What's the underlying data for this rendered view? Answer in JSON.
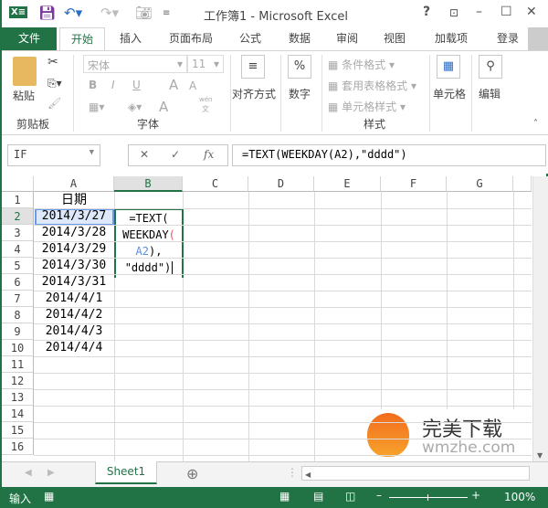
{
  "app": {
    "title": "工作簿1 - Microsoft Excel"
  },
  "tabs": [
    {
      "label": "文件"
    },
    {
      "label": "开始"
    },
    {
      "label": "插入"
    },
    {
      "label": "页面布局"
    },
    {
      "label": "公式"
    },
    {
      "label": "数据"
    },
    {
      "label": "审阅"
    },
    {
      "label": "视图"
    },
    {
      "label": "加载项"
    }
  ],
  "signin": "登录",
  "ribbon": {
    "paste": "粘贴",
    "clipboard": "剪贴板",
    "font_name": "宋体",
    "font_size": "11",
    "bold": "B",
    "italic": "I",
    "underline": "U",
    "grow": "A",
    "shrink": "A",
    "font_color": "A",
    "phonetic_top": "wén",
    "phonetic_bottom": "文",
    "font": "字体",
    "align": "对齐方式",
    "number": "数字",
    "percent": "%",
    "cond_format": "条件格式",
    "table_format": "套用表格格式",
    "cell_style": "单元格样式",
    "styles": "样式",
    "cells": "单元格",
    "editing": "编辑"
  },
  "formula_bar": {
    "name_box": "IF",
    "cancel": "✕",
    "enter": "✓",
    "fx": "fx",
    "formula": "=TEXT(WEEKDAY(A2),\"dddd\")"
  },
  "columns": [
    "A",
    "B",
    "C",
    "D",
    "E",
    "F",
    "G"
  ],
  "rows": [
    "1",
    "2",
    "3",
    "4",
    "5",
    "6",
    "7",
    "8",
    "9",
    "10",
    "11",
    "12",
    "13",
    "14",
    "15",
    "16"
  ],
  "cells": {
    "A": [
      "日期",
      "2014/3/27",
      "2014/3/28",
      "2014/3/29",
      "2014/3/30",
      "2014/3/31",
      "2014/4/1",
      "2014/4/2",
      "2014/4/3",
      "2014/4/4"
    ]
  },
  "edit_cell": {
    "line1": "=TEXT(",
    "line2a": "WEEKDAY",
    "line2b": "(",
    "line3a": "A2",
    "line3b": "),",
    "line4": "\"dddd\")"
  },
  "sheet_tabs": [
    {
      "label": "Sheet1"
    }
  ],
  "status": {
    "mode": "输入",
    "zoom": "100%"
  },
  "watermark": {
    "title": "完美下载",
    "url": "wmzhe.com"
  },
  "colors": {
    "accent": "#217346",
    "ref_blue": "#5b8ee6",
    "paren_red": "#e8556a"
  }
}
